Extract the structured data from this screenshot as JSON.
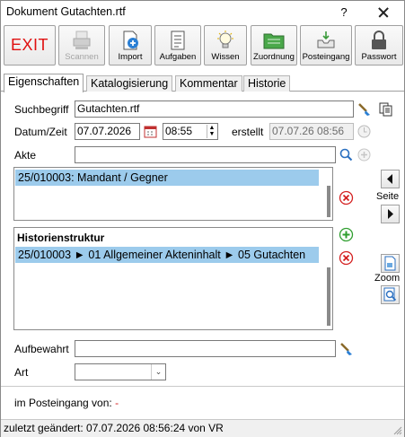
{
  "window": {
    "title": "Dokument Gutachten.rtf",
    "help": "?"
  },
  "toolbar": {
    "exit": "EXIT",
    "scannen": "Scannen",
    "import": "Import",
    "aufgaben": "Aufgaben",
    "wissen": "Wissen",
    "zuordnung": "Zuordnung",
    "posteingang": "Posteingang",
    "passwort": "Passwort"
  },
  "tabs": [
    "Eigenschaften",
    "Katalogisierung",
    "Kommentar",
    "Historie"
  ],
  "form": {
    "suchbegriff_label": "Suchbegriff",
    "suchbegriff_value": "Gutachten.rtf",
    "datumzeit_label": "Datum/Zeit",
    "date_value": "07.07.2026",
    "time_value": "08:55",
    "erstellt_label": "erstellt",
    "erstellt_value": "07.07.26 08:56",
    "akte_label": "Akte",
    "akte_value": "",
    "akte_list": [
      "25/010003: Mandant / Gegner"
    ],
    "historie_heading": "Historienstruktur",
    "historie_row": "25/010003 ► 01 Allgemeiner Akteninhalt ► 05 Gutachten",
    "aufbewahrt_label": "Aufbewahrt",
    "aufbewahrt_value": "",
    "art_label": "Art",
    "art_value": "",
    "posteingang_label": "im Posteingang von:",
    "posteingang_value": "-"
  },
  "side": {
    "seite": "Seite",
    "zoom": "Zoom"
  },
  "status": {
    "text": "zuletzt geändert: 07.07.2026 08:56:24 von VR"
  },
  "colors": {
    "exit": "#e01010",
    "selection": "#9ccbec",
    "delete": "#d42020",
    "add": "#2e9e2e"
  }
}
